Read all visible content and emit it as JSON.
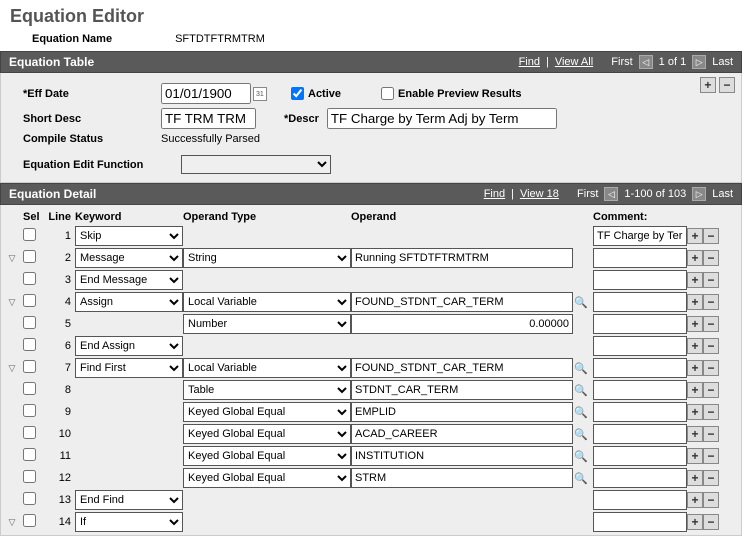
{
  "page": {
    "title": "Equation Editor"
  },
  "header": {
    "name_label": "Equation Name",
    "name_value": "SFTDTFTRMTRM"
  },
  "table_bar": {
    "title": "Equation Table",
    "find": "Find",
    "view_all": "View All",
    "first": "First",
    "counter": "1 of 1",
    "last": "Last"
  },
  "equation_table": {
    "eff_date_label": "Eff Date",
    "eff_date_value": "01/01/1900",
    "active_label": "Active",
    "active_checked": true,
    "preview_label": "Enable Preview Results",
    "preview_checked": false,
    "short_desc_label": "Short Desc",
    "short_desc_value": "TF TRM TRM",
    "descr_label": "Descr",
    "descr_value": "TF Charge by Term Adj by Term",
    "compile_label": "Compile Status",
    "compile_value": "Successfully Parsed",
    "edit_func_label": "Equation Edit Function",
    "edit_func_value": ""
  },
  "detail_bar": {
    "title": "Equation Detail",
    "find": "Find",
    "view": "View 18",
    "first": "First",
    "counter": "1-100 of 103",
    "last": "Last"
  },
  "grid": {
    "headers": {
      "sel": "Sel",
      "line": "Line",
      "keyword": "Keyword",
      "optype": "Operand Type",
      "operand": "Operand",
      "comment": "Comment:"
    },
    "rows": [
      {
        "toggle": "",
        "line": 1,
        "keyword": "Skip",
        "optype": "",
        "operand": "",
        "operand_align": "left",
        "lookup": false,
        "comment": "TF Charge by Term"
      },
      {
        "toggle": "▽",
        "line": 2,
        "keyword": "Message",
        "optype": "String",
        "operand": "Running SFTDTFTRMTRM",
        "operand_align": "left",
        "lookup": false,
        "comment": ""
      },
      {
        "toggle": "",
        "line": 3,
        "keyword": "End Message",
        "optype": "",
        "operand": "",
        "operand_align": "left",
        "lookup": false,
        "comment": ""
      },
      {
        "toggle": "▽",
        "line": 4,
        "keyword": "Assign",
        "optype": "Local Variable",
        "operand": "FOUND_STDNT_CAR_TERM",
        "operand_align": "left",
        "lookup": true,
        "comment": ""
      },
      {
        "toggle": "",
        "line": 5,
        "keyword": "",
        "optype": "Number",
        "operand": "0.00000",
        "operand_align": "right",
        "lookup": false,
        "comment": ""
      },
      {
        "toggle": "",
        "line": 6,
        "keyword": "End Assign",
        "optype": "",
        "operand": "",
        "operand_align": "left",
        "lookup": false,
        "comment": ""
      },
      {
        "toggle": "▽",
        "line": 7,
        "keyword": "Find First",
        "optype": "Local Variable",
        "operand": "FOUND_STDNT_CAR_TERM",
        "operand_align": "left",
        "lookup": true,
        "comment": ""
      },
      {
        "toggle": "",
        "line": 8,
        "keyword": "",
        "optype": "Table",
        "operand": "STDNT_CAR_TERM",
        "operand_align": "left",
        "lookup": true,
        "comment": ""
      },
      {
        "toggle": "",
        "line": 9,
        "keyword": "",
        "optype": "Keyed Global Equal",
        "operand": "EMPLID",
        "operand_align": "left",
        "lookup": true,
        "comment": ""
      },
      {
        "toggle": "",
        "line": 10,
        "keyword": "",
        "optype": "Keyed Global Equal",
        "operand": "ACAD_CAREER",
        "operand_align": "left",
        "lookup": true,
        "comment": ""
      },
      {
        "toggle": "",
        "line": 11,
        "keyword": "",
        "optype": "Keyed Global Equal",
        "operand": "INSTITUTION",
        "operand_align": "left",
        "lookup": true,
        "comment": ""
      },
      {
        "toggle": "",
        "line": 12,
        "keyword": "",
        "optype": "Keyed Global Equal",
        "operand": "STRM",
        "operand_align": "left",
        "lookup": true,
        "comment": ""
      },
      {
        "toggle": "",
        "line": 13,
        "keyword": "End Find",
        "optype": "",
        "operand": "",
        "operand_align": "left",
        "lookup": false,
        "comment": ""
      },
      {
        "toggle": "▽",
        "line": 14,
        "keyword": "If",
        "optype": "",
        "operand": "",
        "operand_align": "left",
        "lookup": false,
        "comment": ""
      }
    ]
  },
  "icons": {
    "plus": "+",
    "minus": "−",
    "lookup": "🔍",
    "prev": "◁",
    "next": "▷"
  }
}
